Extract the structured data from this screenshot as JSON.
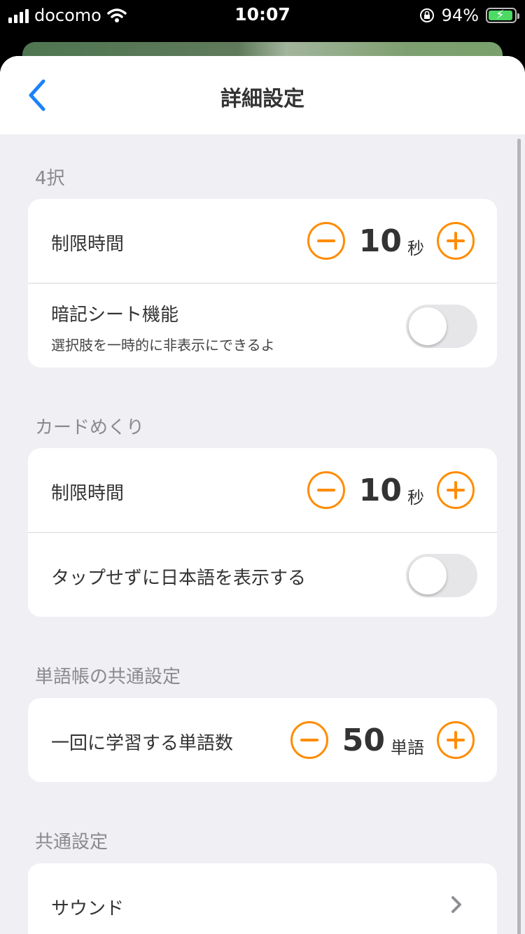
{
  "status": {
    "carrier": "docomo",
    "time": "10:07",
    "battery": "94%",
    "battery_level": 0.94,
    "colors": {
      "battery_fill": "#4cd964"
    }
  },
  "nav": {
    "title": "詳細設定",
    "back_icon": "chevron-left-icon"
  },
  "accent_color": "#ff8c00",
  "sections": {
    "four_choice": {
      "header": "4択",
      "time_limit": {
        "label": "制限時間",
        "value": "10",
        "unit": "秒"
      },
      "memory_sheet": {
        "label": "暗記シート機能",
        "sublabel": "選択肢を一時的に非表示にできるよ",
        "enabled": false
      }
    },
    "card_flip": {
      "header": "カードめくり",
      "time_limit": {
        "label": "制限時間",
        "value": "10",
        "unit": "秒"
      },
      "show_japanese": {
        "label": "タップせずに日本語を表示する",
        "enabled": false
      }
    },
    "wordbook_common": {
      "header": "単語帳の共通設定",
      "words_per_session": {
        "label": "一回に学習する単語数",
        "value": "50",
        "unit": "単語"
      }
    },
    "common": {
      "header": "共通設定",
      "sound": {
        "label": "サウンド"
      }
    }
  }
}
